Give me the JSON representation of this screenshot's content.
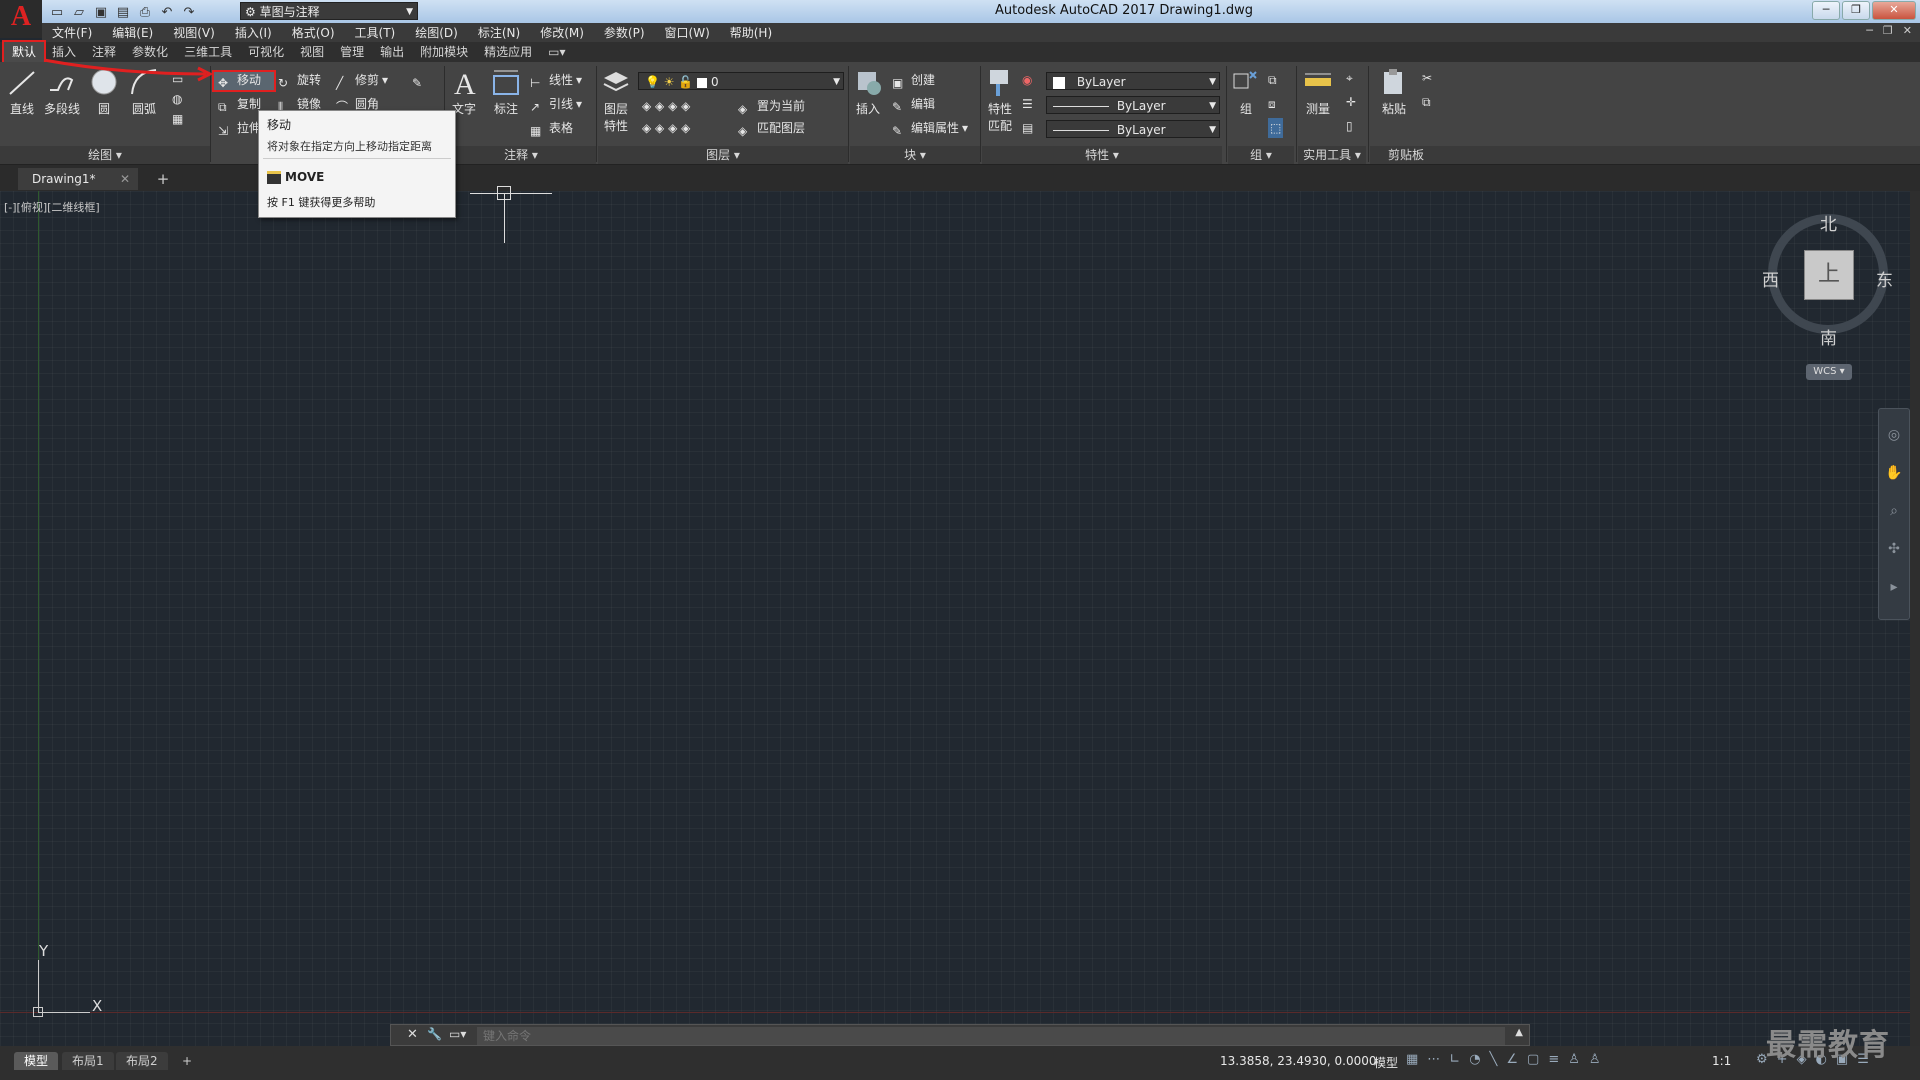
{
  "window": {
    "title": "Autodesk AutoCAD 2017    Drawing1.dwg",
    "workspace": "草图与注释"
  },
  "menu": [
    "文件(F)",
    "编辑(E)",
    "视图(V)",
    "插入(I)",
    "格式(O)",
    "工具(T)",
    "绘图(D)",
    "标注(N)",
    "修改(M)",
    "参数(P)",
    "窗口(W)",
    "帮助(H)"
  ],
  "ribbon_tabs": [
    "默认",
    "插入",
    "注释",
    "参数化",
    "三维工具",
    "可视化",
    "视图",
    "管理",
    "输出",
    "附加模块",
    "精选应用"
  ],
  "draw_panel": {
    "title": "绘图",
    "line": "直线",
    "polyline": "多段线",
    "circle": "圆",
    "arc": "圆弧"
  },
  "modify_panel": {
    "move": "移动",
    "rotate": "旋转",
    "trim": "修剪",
    "copy": "复制",
    "mirror": "镜像",
    "fillet": "圆角",
    "stretch": "拉伸"
  },
  "annotation_panel": {
    "title": "注释",
    "text": "文字",
    "dimension": "标注",
    "linear": "线性",
    "leader": "引线",
    "table": "表格"
  },
  "layers_panel": {
    "title": "图层",
    "properties_l1": "图层",
    "properties_l2": "特性",
    "current_layer": "0",
    "set_current": "置为当前",
    "match_layer": "匹配图层"
  },
  "block_panel": {
    "title": "块",
    "insert": "插入",
    "create": "创建",
    "edit": "编辑",
    "edit_attr": "编辑属性"
  },
  "properties_panel": {
    "title": "特性",
    "match_l1": "特性",
    "match_l2": "匹配",
    "color": "ByLayer",
    "linetype": "ByLayer",
    "lineweight": "ByLayer"
  },
  "groups_panel": {
    "title": "组",
    "group": "组"
  },
  "utilities_panel": {
    "title": "实用工具",
    "measure": "测量"
  },
  "clipboard_panel": {
    "title": "剪贴板",
    "paste": "粘贴"
  },
  "tooltip": {
    "title": "移动",
    "description": "将对象在指定方向上移动指定距离",
    "command": "MOVE",
    "help": "按 F1 键获得更多帮助"
  },
  "document_tab": "Drawing1*",
  "viewport_label": "[-][俯视][二维线框]",
  "viewcube": {
    "north": "北",
    "south": "南",
    "east": "东",
    "west": "西",
    "face": "上",
    "wcs": "WCS"
  },
  "ucs": {
    "x": "X",
    "y": "Y"
  },
  "command_line": {
    "placeholder": "键入命令"
  },
  "layout_tabs": [
    "模型",
    "布局1",
    "布局2"
  ],
  "status": {
    "coords": "13.3858, 23.4930, 0.0000",
    "mode": "模型",
    "scale": "1:1"
  },
  "watermark": "最需教育",
  "colors": {
    "highlight": "#e02020",
    "canvas": "#212830"
  }
}
